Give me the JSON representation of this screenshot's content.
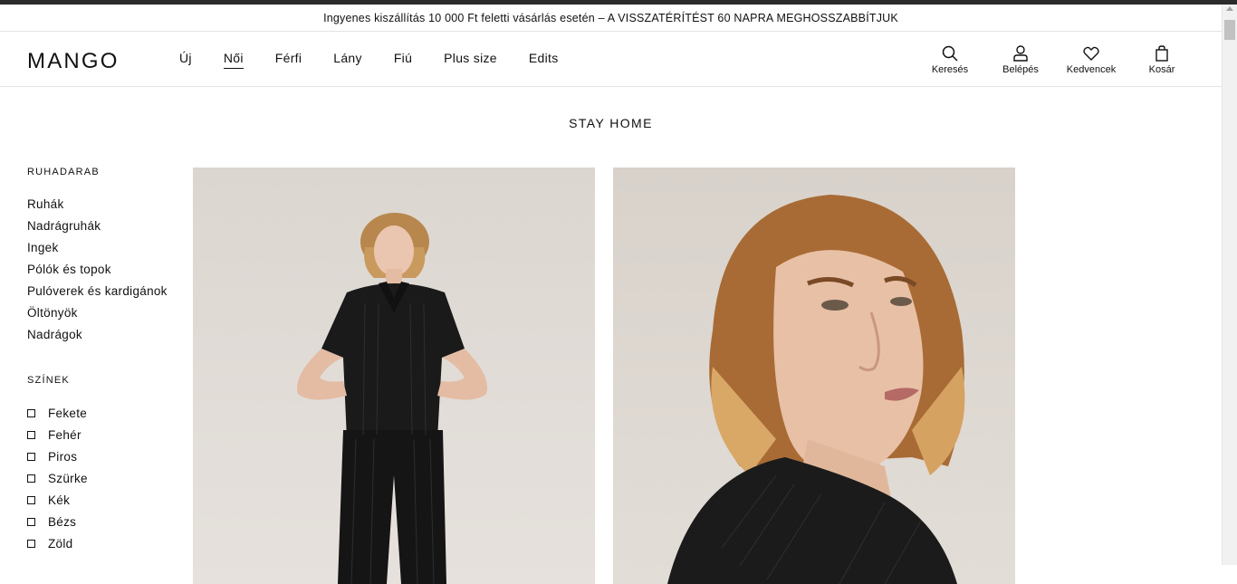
{
  "promo": {
    "text": "Ingyenes kiszállítás 10 000 Ft feletti vásárlás esetén – A VISSZATÉRÍTÉST 60 NAPRA MEGHOSSZABBÍTJUK"
  },
  "header": {
    "logo": "MANGO",
    "nav": [
      {
        "label": "Új",
        "active": false
      },
      {
        "label": "Női",
        "active": true
      },
      {
        "label": "Férfi",
        "active": false
      },
      {
        "label": "Lány",
        "active": false
      },
      {
        "label": "Fiú",
        "active": false
      },
      {
        "label": "Plus size",
        "active": false
      },
      {
        "label": "Edits",
        "active": false
      }
    ],
    "actions": [
      {
        "label": "Keresés",
        "icon": "search-icon"
      },
      {
        "label": "Belépés",
        "icon": "user-icon"
      },
      {
        "label": "Kedvencek",
        "icon": "heart-icon"
      },
      {
        "label": "Kosár",
        "icon": "shopping-bag-icon"
      }
    ]
  },
  "page": {
    "title": "STAY HOME"
  },
  "sidebar": {
    "garments_heading": "RUHADARAB",
    "garments": [
      "Ruhák",
      "Nadrágruhák",
      "Ingek",
      "Pólók és topok",
      "Pulóverek és kardigánok",
      "Öltönyök",
      "Nadrágok"
    ],
    "colors_heading": "SZÍNEK",
    "colors": [
      "Fekete",
      "Fehér",
      "Piros",
      "Szürke",
      "Kék",
      "Bézs",
      "Zöld"
    ]
  },
  "products": [
    {
      "image": "model-full-body-black-pleated-outfit"
    },
    {
      "image": "model-portrait-black-pleated-shirt"
    }
  ],
  "colors": {
    "text": "#111111",
    "border": "#e2e2e2",
    "topline": "#2b2b2b"
  }
}
